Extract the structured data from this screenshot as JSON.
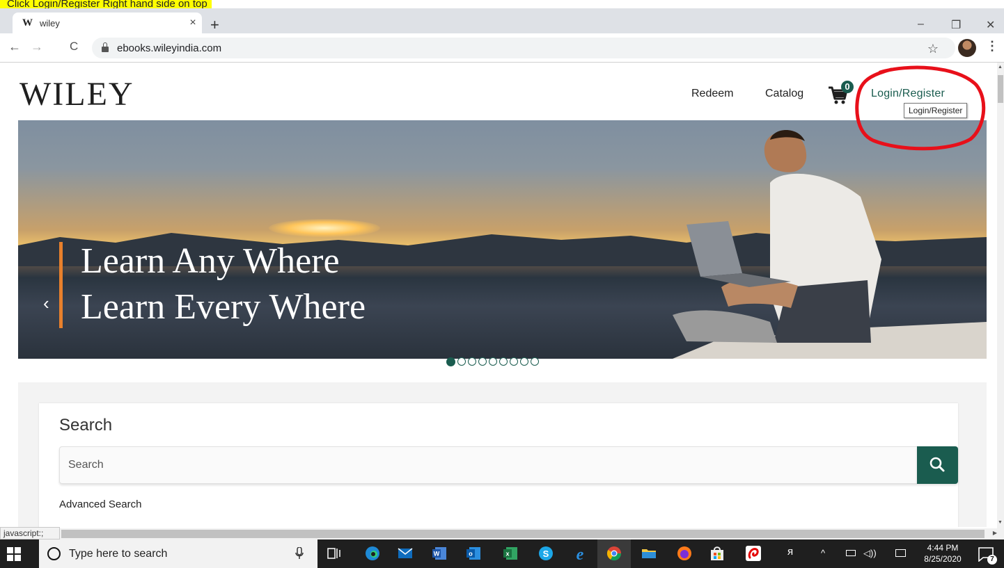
{
  "annotation": {
    "text": "Click Login/Register Right hand side on top"
  },
  "browser": {
    "tab": {
      "favicon": "W",
      "title": "wiley",
      "close": "×"
    },
    "new_tab": "+",
    "window_controls": {
      "minimize": "–",
      "restore": "❐",
      "close": "✕"
    },
    "nav": {
      "back": "←",
      "forward": "→",
      "reload": "C"
    },
    "url": "ebooks.wileyindia.com",
    "bookmark_star": "☆",
    "menu": "⋮"
  },
  "site": {
    "logo": "WILEY",
    "nav": {
      "redeem": "Redeem",
      "catalog": "Catalog",
      "cart_count": "0",
      "login": "Login/Register"
    },
    "tooltip": "Login/Register",
    "hero": {
      "line1": "Learn Any Where",
      "line2": "Learn Every Where",
      "prev": "‹",
      "next": "›",
      "slide_count": 9,
      "active_slide": 1
    },
    "search": {
      "heading": "Search",
      "placeholder": "Search",
      "advanced": "Advanced Search"
    }
  },
  "status": {
    "text": "javascript:;"
  },
  "taskbar": {
    "search_placeholder": "Type here to search",
    "time": "4:44 PM",
    "date": "8/25/2020",
    "notification_count": "7"
  },
  "colors": {
    "brand_green": "#1a5c4f",
    "accent_orange": "#e8802c",
    "annotation_yellow": "#ffff00",
    "annotation_circle": "#e8101a"
  },
  "icons": {
    "cart": "cart-icon",
    "search": "magnifier-icon",
    "lock": "lock-icon",
    "windows": "windows-logo-icon"
  }
}
